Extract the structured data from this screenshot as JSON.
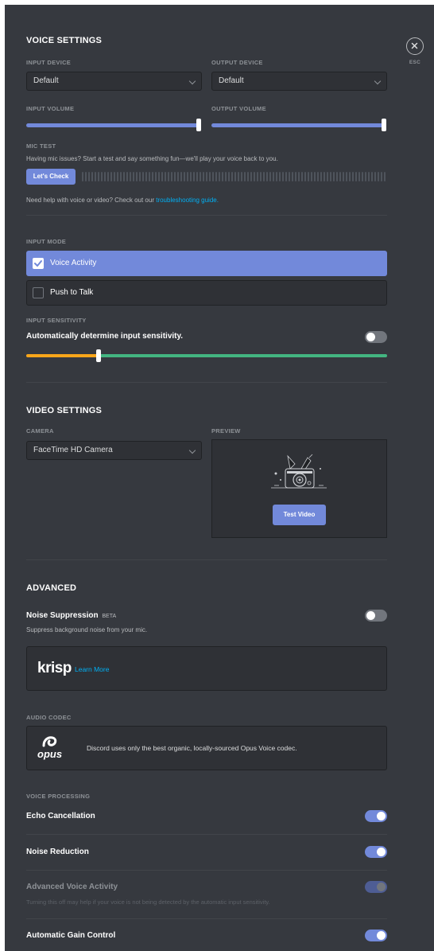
{
  "close": {
    "esc_label": "ESC"
  },
  "voice": {
    "title": "VOICE SETTINGS",
    "input_device_label": "INPUT DEVICE",
    "input_device_value": "Default",
    "output_device_label": "OUTPUT DEVICE",
    "output_device_value": "Default",
    "input_volume_label": "INPUT VOLUME",
    "input_volume_level": 0.97,
    "output_volume_label": "OUTPUT VOLUME",
    "output_volume_level": 0.97,
    "mic_test_label": "MIC TEST",
    "mic_test_desc": "Having mic issues? Start a test and say something fun—we'll play your voice back to you.",
    "lets_check_button": "Let's Check",
    "help_text": "Need help with voice or video? Check out our",
    "help_link": "troubleshooting guide."
  },
  "input_mode": {
    "label": "INPUT MODE",
    "voice_activity": "Voice Activity",
    "voice_activity_selected": true,
    "push_to_talk": "Push to Talk",
    "sensitivity_label": "INPUT SENSITIVITY",
    "auto_sensitivity_label": "Automatically determine input sensitivity.",
    "auto_sensitivity_on": false,
    "sensitivity_level": 0.2
  },
  "video": {
    "title": "VIDEO SETTINGS",
    "camera_label": "CAMERA",
    "camera_value": "FaceTime HD Camera",
    "preview_label": "PREVIEW",
    "test_video_button": "Test Video"
  },
  "advanced": {
    "title": "ADVANCED",
    "noise_suppression_label": "Noise Suppression",
    "beta_tag": "BETA",
    "noise_suppression_desc": "Suppress background noise from your mic.",
    "noise_suppression_on": false,
    "krisp_logo": "krisp",
    "krisp_learn_more": "Learn More",
    "audio_codec_label": "AUDIO CODEC",
    "opus_logo": "opus",
    "opus_desc": "Discord uses only the best organic, locally-sourced Opus Voice codec.",
    "voice_processing_label": "VOICE PROCESSING",
    "echo_cancellation": "Echo Cancellation",
    "echo_cancellation_on": true,
    "noise_reduction": "Noise Reduction",
    "noise_reduction_on": true,
    "advanced_voice_activity": "Advanced Voice Activity",
    "advanced_voice_activity_desc": "Turning this off may help if your voice is not being detected by the automatic input sensitivity.",
    "advanced_voice_activity_on": true,
    "automatic_gain_control": "Automatic Gain Control",
    "automatic_gain_control_on": true
  },
  "colors": {
    "background": "#36393f",
    "accent": "#7289da",
    "link": "#00b0f4",
    "sensitivity_low": "#faa61a",
    "sensitivity_high": "#43b581"
  }
}
